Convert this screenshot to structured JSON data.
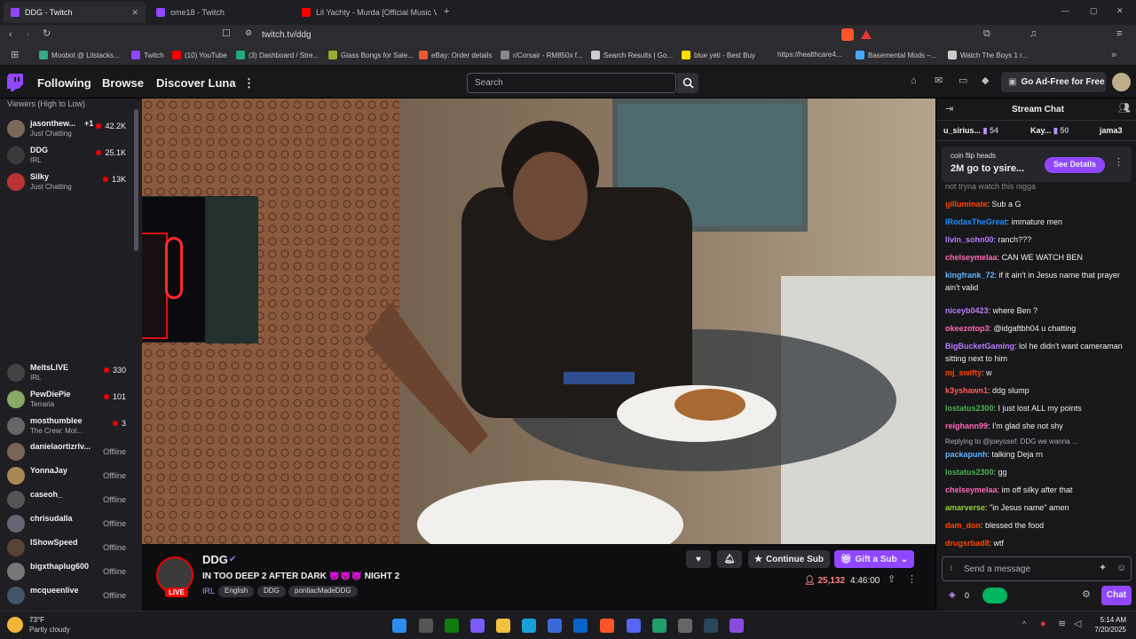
{
  "browser": {
    "tabs": [
      {
        "label": "DDG - Twitch",
        "color": "#9146ff"
      },
      {
        "label": "ome18 - Twitch",
        "color": "#9146ff"
      },
      {
        "label": "Lil Yachty - Murda [Official Music Vid",
        "color": "#ff0000"
      }
    ],
    "url": "twitch.tv/ddg",
    "bookmarks": [
      "Moobot @ Lilstacks...",
      "Twitch",
      "(10) YouTube",
      "(3) Dashboard / Stre...",
      "Glass Bongs for Sale...",
      "eBay: Order details",
      "r/Corsair - RM850x f...",
      "Search Results | Go...",
      "blue yeti - Best Buy",
      "https://healthcare4...",
      "Basemental Mods –...",
      "Watch The Boys 1 r..."
    ]
  },
  "nav": {
    "following": "Following",
    "browse": "Browse",
    "discover": "Discover Luna",
    "search_placeholder": "Search",
    "ad_free": "Go Ad-Free for Free"
  },
  "sidebar": {
    "sort_label": "Viewers (High to Low)",
    "channels": [
      {
        "name": "jasonthew...",
        "extra": "+1",
        "sub": "Just Chatting",
        "viewers": "42.2K",
        "color": "#7a6a5a"
      },
      {
        "name": "DDG",
        "extra": "",
        "sub": "IRL",
        "viewers": "25.1K",
        "color": "#3a3a3a"
      },
      {
        "name": "Silky",
        "extra": "",
        "sub": "Just Chatting",
        "viewers": "13K",
        "color": "#b33"
      },
      {
        "name": "MeltsLIVE",
        "extra": "",
        "sub": "IRL",
        "viewers": "330",
        "color": "#444"
      },
      {
        "name": "PewDiePie",
        "extra": "",
        "sub": "Terraria",
        "viewers": "101",
        "color": "#8a6"
      },
      {
        "name": "mosthumblee",
        "extra": "",
        "sub": "The Crew: Mot...",
        "viewers": "3",
        "color": "#666"
      },
      {
        "name": "danielaortizrlv...",
        "extra": "",
        "sub": "",
        "viewers": "Offline",
        "color": "#765"
      },
      {
        "name": "YonnaJay",
        "extra": "",
        "sub": "",
        "viewers": "Offline",
        "color": "#a85"
      },
      {
        "name": "caseoh_",
        "extra": "",
        "sub": "",
        "viewers": "Offline",
        "color": "#555"
      },
      {
        "name": "chrisudalla",
        "extra": "",
        "sub": "",
        "viewers": "Offline",
        "color": "#667"
      },
      {
        "name": "IShowSpeed",
        "extra": "",
        "sub": "",
        "viewers": "Offline",
        "color": "#543"
      },
      {
        "name": "bigxthaplug600",
        "extra": "",
        "sub": "",
        "viewers": "Offline",
        "color": "#777"
      },
      {
        "name": "mcqueenlive",
        "extra": "",
        "sub": "",
        "viewers": "Offline",
        "color": "#456"
      }
    ]
  },
  "stream": {
    "channel": "DDG",
    "live": "LIVE",
    "title": "IN TOO DEEP 2 AFTER DARK 😈😈😈 NIGHT 2",
    "tags": [
      "IRL",
      "English",
      "DDG",
      "pontiacMadeDDG"
    ],
    "viewers": "25,132",
    "uptime": "4:46:00",
    "continue_sub": "Continue Sub",
    "gift_sub": "Gift a Sub"
  },
  "chat": {
    "header": "Stream Chat",
    "leaders": [
      {
        "name": "u_sirius...",
        "count": "54"
      },
      {
        "name": "Kay...",
        "count": "50"
      },
      {
        "name": "jama3",
        "count": ""
      }
    ],
    "prediction": {
      "title": "coin flip heads",
      "amount": "2M go to ysire...",
      "button": "See Details"
    },
    "messages": [
      {
        "user": "gilluminate",
        "text": "Sub a G",
        "color": "#ff4500"
      },
      {
        "user": "IRodaxTheGreat",
        "text": "immature men",
        "color": "#1e90ff"
      },
      {
        "user": "livin_sohn00",
        "text": "ranch???",
        "color": "#b87cff"
      },
      {
        "user": "chelseymelaa",
        "text": "CAN WE WATCH BEN",
        "color": "#ff69b4"
      },
      {
        "user": "kingfrank_72",
        "text": "if it ain't in Jesus name that prayer ain't valid",
        "color": "#5fb3ff"
      },
      {
        "user": "niceyb0423",
        "text": "where Ben ?",
        "color": "#b87cff"
      },
      {
        "user": "okeezotop3",
        "text": "@idgaftbh04 u chatting",
        "color": "#ff69b4"
      },
      {
        "user": "BigBucketGaming",
        "text": "lol he didn't want cameraman sitting next to him",
        "color": "#b87cff"
      },
      {
        "user": "mj_swifty",
        "text": "w",
        "color": "#ff4500"
      },
      {
        "user": "k3yshawn1",
        "text": "ddg slump",
        "color": "#ff5c5c"
      },
      {
        "user": "lostatus2300",
        "text": "I just lost ALL my points",
        "color": "#4caf50"
      },
      {
        "user": "reighann99",
        "text": "I'm glad she not shy",
        "color": "#ff69b4"
      },
      {
        "user": "packapunh",
        "text": "talking Deja rn",
        "color": "#5fb3ff"
      },
      {
        "user": "lostatus2300",
        "text": "gg",
        "color": "#4caf50"
      },
      {
        "user": "chelseymelaa",
        "text": "im off silky after that",
        "color": "#ff69b4"
      },
      {
        "user": "amarverse",
        "text": "\"in Jesus name\" amen",
        "color": "#9acd32"
      },
      {
        "user": "dam_don",
        "text": "blessed the food",
        "color": "#ff4500"
      },
      {
        "user": "drugsrbad8",
        "text": "wtf",
        "color": "#ff4500"
      }
    ],
    "reply_note": "Replying to @joeyosef: DDG we wanna ...",
    "top_cut": "not tryna watch this nigga",
    "input_placeholder": "Send a message",
    "points": "0",
    "chat_button": "Chat"
  },
  "taskbar": {
    "temp": "73°F",
    "weather": "Partly cloudy",
    "time": "5:14 AM",
    "date": "7/20/2025"
  }
}
